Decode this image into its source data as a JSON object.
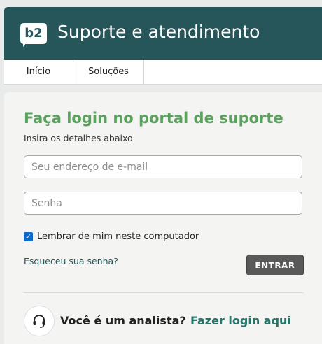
{
  "brand": {
    "logo_text": "b2",
    "title": "Suporte e atendimento"
  },
  "nav": {
    "items": [
      {
        "label": "Início"
      },
      {
        "label": "Soluções"
      }
    ]
  },
  "login": {
    "title": "Faça login no portal de suporte",
    "subtitle": "Insira os detalhes abaixo",
    "email_placeholder": "Seu endereço de e-mail",
    "password_placeholder": "Senha",
    "remember_label": "Lembrar de mim neste computador",
    "remember_checked": true,
    "forgot_label": "Esqueceu sua senha?",
    "submit_label": "ENTRAR"
  },
  "analyst": {
    "question": "Você é um analista?",
    "link_label": "Fazer login aqui",
    "icon": "headset-icon"
  },
  "colors": {
    "header_bg": "#26555a",
    "title_green": "#5ba25f",
    "button_bg": "#595959",
    "link_teal": "#26756a"
  }
}
